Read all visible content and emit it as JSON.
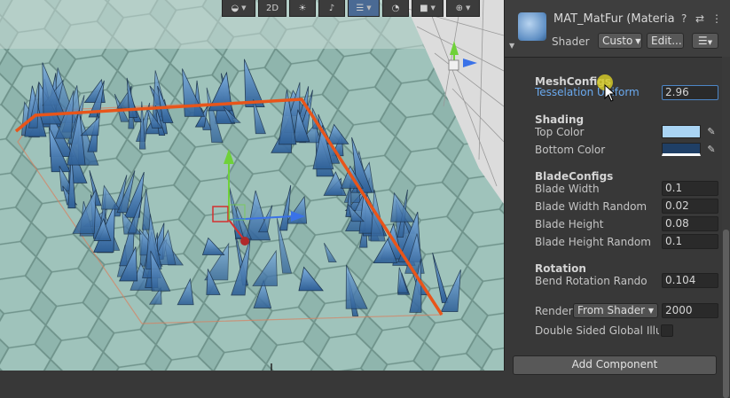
{
  "scene_toolbar": {
    "buttons": [
      {
        "name": "globe-dropdown",
        "icon": "globe-icon",
        "label": "◒"
      },
      {
        "name": "2d-toggle",
        "label": "2D"
      },
      {
        "name": "lighting-toggle",
        "icon": "bulb-icon",
        "label": "☀"
      },
      {
        "name": "audio-toggle",
        "icon": "speaker-icon",
        "label": "♪"
      },
      {
        "name": "fx-dropdown",
        "icon": "layers-icon",
        "label": "☰"
      },
      {
        "name": "hidden-toggle",
        "icon": "eye-slash-icon",
        "label": "◔"
      },
      {
        "name": "camera-dropdown",
        "icon": "camera-icon",
        "label": "■"
      },
      {
        "name": "gizmos-dropdown",
        "icon": "gizmo-icon",
        "label": "⊕"
      }
    ]
  },
  "inspector": {
    "material_title": "MAT_MatFur (Materia",
    "shader_label": "Shader",
    "shader_value": "Custo",
    "edit_button": "Edit...",
    "menu_icon": "list-menu-icon",
    "sections": {
      "meshconfigs": "MeshConfigs",
      "shading": "Shading",
      "bladeconfigs": "BladeConfigs",
      "rotation": "Rotation"
    },
    "props": {
      "tesselation_label": "Tesselation Uniform",
      "tesselation_value": "2.96",
      "top_color_label": "Top Color",
      "bottom_color_label": "Bottom Color",
      "blade_width_label": "Blade Width",
      "blade_width_value": "0.1",
      "blade_width_random_label": "Blade Width Random",
      "blade_width_random_value": "0.02",
      "blade_height_label": "Blade Height",
      "blade_height_value": "0.08",
      "blade_height_random_label": "Blade Height Random",
      "blade_height_random_value": "0.1",
      "bend_rotation_label": "Bend Rotation Rando",
      "bend_rotation_value": "0.104",
      "render_label": "Render",
      "render_queue_option": "From Shader",
      "render_queue_value": "2000",
      "double_sided_label": "Double Sided Global Illum"
    },
    "colors": {
      "top_color": "#a9d4f4",
      "bottom_color": "#1f3f66"
    },
    "add_component": "Add Component"
  }
}
